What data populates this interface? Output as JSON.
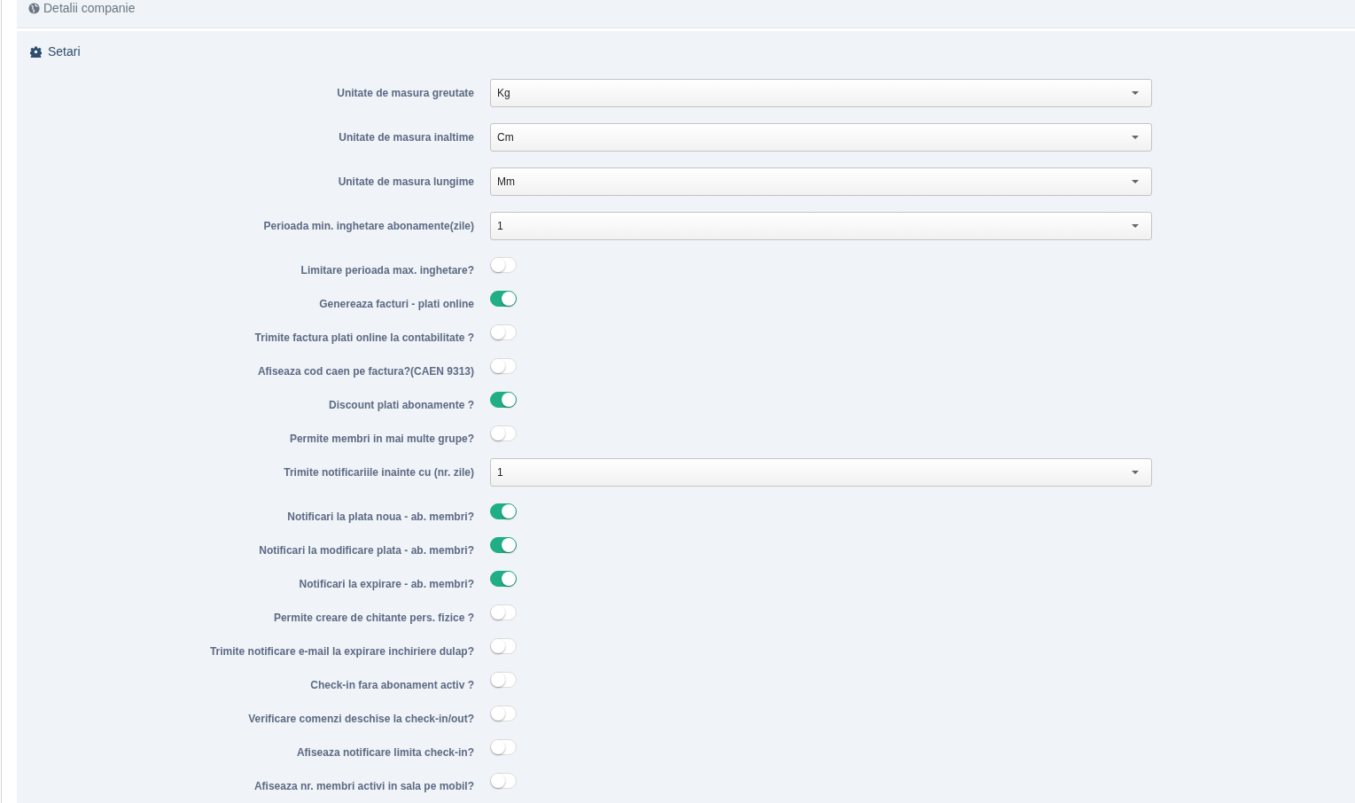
{
  "company_panel": {
    "title": "Detalii companie"
  },
  "settings_panel": {
    "title": "Setari",
    "rows": [
      {
        "kind": "select",
        "label": "Unitate de masura greutate",
        "value": "Kg"
      },
      {
        "kind": "select",
        "label": "Unitate de masura inaltime",
        "value": "Cm"
      },
      {
        "kind": "select",
        "label": "Unitate de masura lungime",
        "value": "Mm"
      },
      {
        "kind": "select",
        "label": "Perioada min. inghetare abonamente(zile)",
        "value": "1"
      },
      {
        "kind": "toggle",
        "label": "Limitare perioada max. inghetare?",
        "on": false
      },
      {
        "kind": "toggle",
        "label": "Genereaza facturi - plati online",
        "on": true
      },
      {
        "kind": "toggle",
        "label": "Trimite factura plati online la contabilitate ?",
        "on": false
      },
      {
        "kind": "toggle",
        "label": "Afiseaza cod caen pe factura?(CAEN 9313)",
        "on": false
      },
      {
        "kind": "toggle",
        "label": "Discount plati abonamente ?",
        "on": true
      },
      {
        "kind": "toggle",
        "label": "Permite membri in mai multe grupe?",
        "on": false
      },
      {
        "kind": "select",
        "label": "Trimite notificariile inainte cu (nr. zile)",
        "value": "1"
      },
      {
        "kind": "toggle",
        "label": "Notificari la plata noua - ab. membri?",
        "on": true
      },
      {
        "kind": "toggle",
        "label": "Notificari la modificare plata - ab. membri?",
        "on": true
      },
      {
        "kind": "toggle",
        "label": "Notificari la expirare - ab. membri?",
        "on": true
      },
      {
        "kind": "toggle",
        "label": "Permite creare de chitante pers. fizice ?",
        "on": false
      },
      {
        "kind": "toggle",
        "label": "Trimite notificare e-mail la expirare inchiriere dulap?",
        "on": false
      },
      {
        "kind": "toggle",
        "label": "Check-in fara abonament activ ?",
        "on": false
      },
      {
        "kind": "toggle",
        "label": "Verificare comenzi deschise la check-in/out?",
        "on": false
      },
      {
        "kind": "toggle",
        "label": "Afiseaza notificare limita check-in?",
        "on": false
      },
      {
        "kind": "toggle",
        "label": "Afiseaza nr. membri activi in sala pe mobil?",
        "on": false
      }
    ]
  }
}
